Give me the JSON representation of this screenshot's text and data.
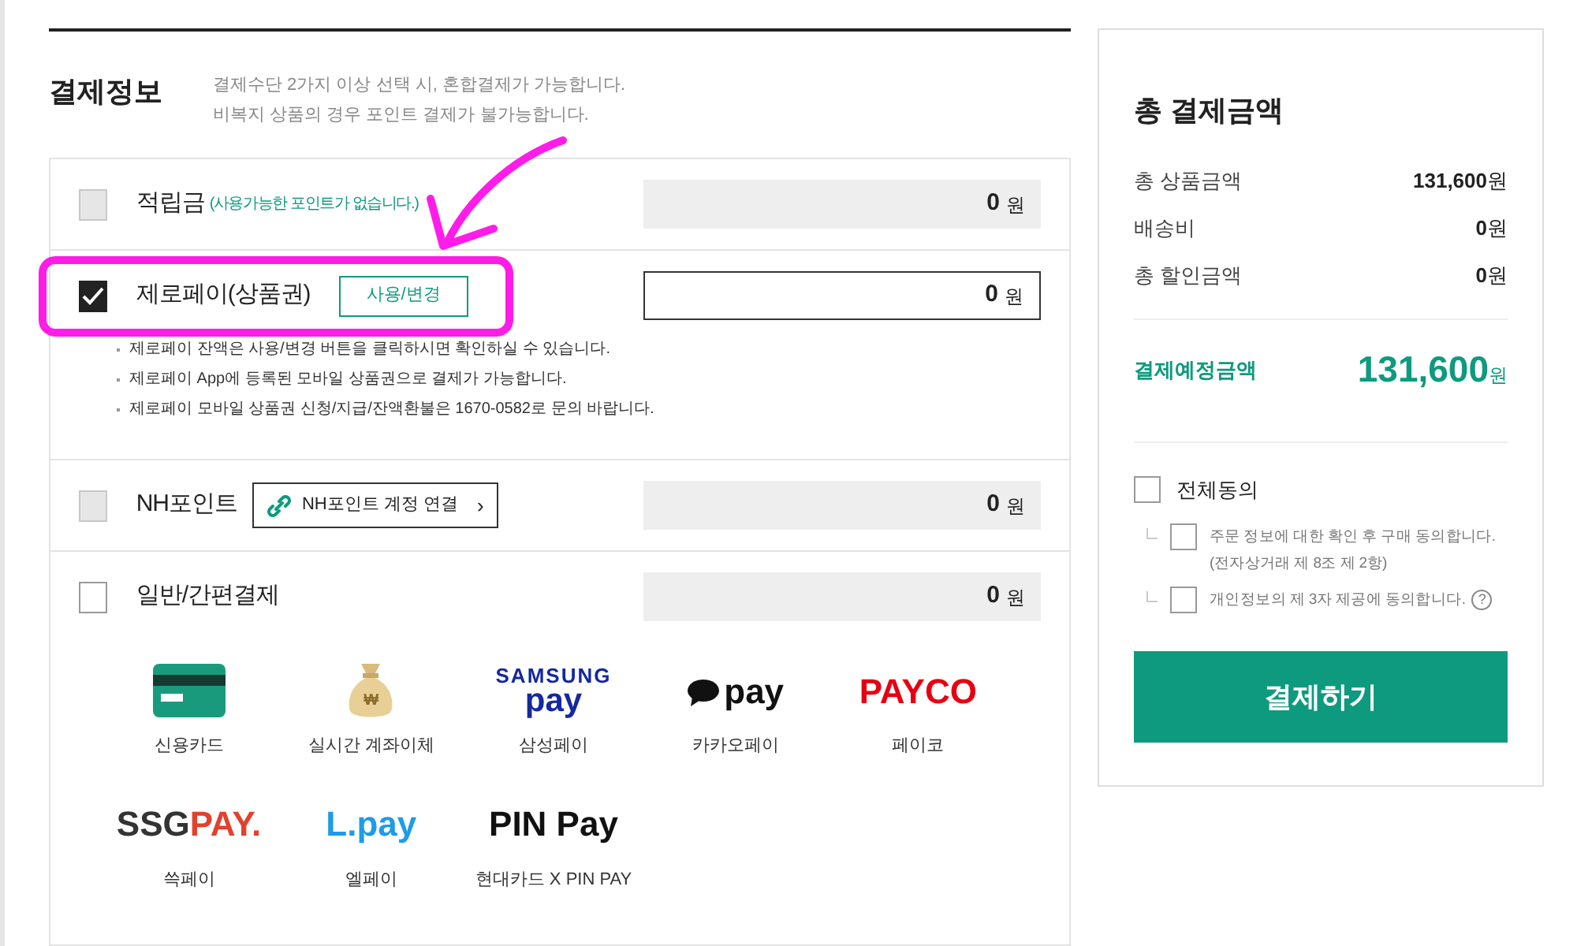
{
  "section": {
    "title": "결제정보",
    "notes": [
      "결제수단 2가지 이상 선택 시, 혼합결제가 가능합니다.",
      "비복지 상품의 경우 포인트 결제가 불가능합니다."
    ]
  },
  "methods": [
    {
      "label": "적립금",
      "note": "(사용가능한 포인트가 없습니다.)",
      "checked": false,
      "disabled": true,
      "editable": false,
      "amount": "0",
      "unit": "원"
    },
    {
      "label": "제로페이(상품권)",
      "button": {
        "kind": "outline",
        "label": "사용/변경"
      },
      "checked": true,
      "editable": true,
      "amount": "0",
      "unit": "원",
      "highlight": true,
      "info": [
        "제로페이 잔액은 사용/변경 버튼을 클릭하시면 확인하실 수 있습니다.",
        "제로페이 App에 등록된 모바일 상품권으로 결제가 가능합니다.",
        "제로페이 모바일 상품권 신청/지급/잔액환불은 1670-0582로 문의 바랍니다."
      ]
    },
    {
      "label": "NH포인트",
      "button": {
        "kind": "link",
        "label": "NH포인트 계정 연결",
        "arrow": "›"
      },
      "checked": false,
      "disabled": true,
      "editable": false,
      "amount": "0",
      "unit": "원"
    },
    {
      "label": "일반/간편결제",
      "checked": false,
      "disabled": false,
      "editable": false,
      "amount": "0",
      "unit": "원"
    }
  ],
  "pay_options": [
    {
      "kind": "card",
      "caption": "신용카드"
    },
    {
      "kind": "bag",
      "caption": "실시간 계좌이체",
      "symbol": "₩"
    },
    {
      "kind": "stack",
      "logo": [
        {
          "text": "SAMSUNG",
          "color": "#1428a0"
        },
        {
          "text": "pay",
          "color": "#1428a0"
        }
      ],
      "caption": "삼성페이"
    },
    {
      "kind": "bubble",
      "logo": [
        {
          "text": "pay",
          "color": "#111111"
        }
      ],
      "caption": "카카오페이"
    },
    {
      "kind": "text",
      "logo": [
        {
          "text": "PAYCO",
          "color": "#e60012"
        }
      ],
      "caption": "페이코"
    },
    {
      "kind": "text",
      "logo": [
        {
          "text": "SSG",
          "color": "#333333"
        },
        {
          "text": "PAY.",
          "color": "#e2412e"
        }
      ],
      "caption": "쓱페이"
    },
    {
      "kind": "text",
      "logo": [
        {
          "text": "L.pay",
          "color": "#1e9be9"
        }
      ],
      "caption": "엘페이"
    },
    {
      "kind": "text",
      "logo": [
        {
          "text": "PIN Pay",
          "color": "#111111"
        }
      ],
      "caption": "현대카드 X PIN PAY"
    }
  ],
  "summary": {
    "title": "총 결제금액",
    "rows": [
      {
        "label": "총 상품금액",
        "value": "131,600",
        "unit": "원"
      },
      {
        "label": "배송비",
        "value": "0",
        "unit": "원"
      },
      {
        "label": "총 할인금액",
        "value": "0",
        "unit": "원"
      }
    ],
    "total": {
      "label": "결제예정금액",
      "value": "131,600",
      "unit": "원"
    },
    "agree_all": {
      "label": "전체동의",
      "checked": false
    },
    "agreements": [
      {
        "lines": [
          "주문 정보에 대한 확인 후 구매 동의합니다.",
          "(전자상거래 제 8조 제 2항)"
        ],
        "checked": false
      },
      {
        "lines": [
          "개인정보의 제 3자 제공에 동의합니다."
        ],
        "checked": false,
        "help": true,
        "help_label": "?"
      }
    ],
    "pay_button": "결제하기"
  }
}
